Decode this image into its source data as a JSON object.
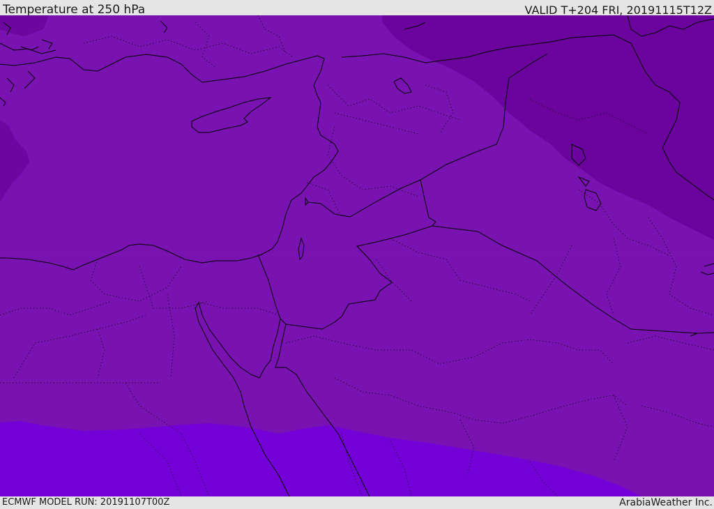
{
  "header": {
    "title": "Temperature at 250 hPa",
    "valid": "VALID T+204 FRI, 20191115T12Z"
  },
  "footer": {
    "model_run": "ECMWF MODEL RUN: 20191107T00Z",
    "credit": "ArabiaWeather Inc."
  },
  "map": {
    "region": "Eastern Mediterranean and Middle East",
    "colors": {
      "band_mid": "#7812b0",
      "band_dark_ne": "#6a049c",
      "band_dark_west": "#6b069e",
      "band_south": "#7400d8",
      "coastline": "#000000",
      "country_border": "#000000",
      "admin_border": "#1a0a26"
    }
  }
}
